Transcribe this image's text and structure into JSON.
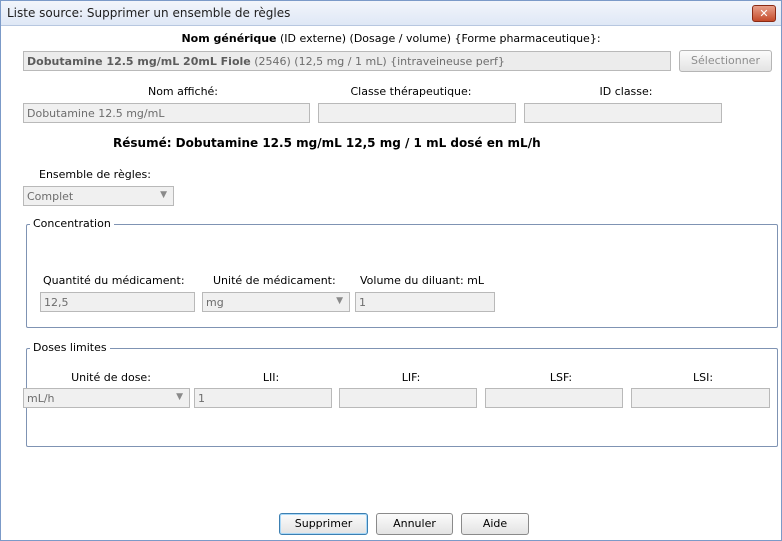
{
  "window": {
    "title": "Liste source: Supprimer un ensemble de règles",
    "close_glyph": "✕"
  },
  "generic": {
    "header_bold": "Nom générique",
    "header_rest": "(ID externe) (Dosage / volume) {Forme pharmaceutique}:",
    "name_main": "Dobutamine 12.5 mg/mL 20mL Fiole",
    "name_rest": "(2546) (12,5 mg / 1 mL) {intraveineuse perf}",
    "select_label": "Sélectionner"
  },
  "display": {
    "nom_affiche_label": "Nom affiché:",
    "classe_label": "Classe thérapeutique:",
    "id_classe_label": "ID classe:",
    "nom_affiche_value": "Dobutamine 12.5 mg/mL",
    "classe_value": "",
    "id_classe_value": ""
  },
  "summary": {
    "text": "Résumé: Dobutamine 12.5 mg/mL 12,5 mg / 1 mL dosé en mL/h"
  },
  "ruleset": {
    "label": "Ensemble de règles:",
    "value": "Complet"
  },
  "concentration": {
    "legend": "Concentration",
    "qty_label": "Quantité du médicament:",
    "unit_label": "Unité de médicament:",
    "diluent_label": "Volume du diluant: mL",
    "qty_value": "12,5",
    "unit_value": "mg",
    "diluent_value": "1"
  },
  "limits": {
    "legend": "Doses limites",
    "dose_unit_label": "Unité de dose:",
    "lii_label": "LII:",
    "lif_label": "LIF:",
    "lsf_label": "LSF:",
    "lsi_label": "LSI:",
    "dose_unit_value": "mL/h",
    "lii_value": "1",
    "lif_value": "",
    "lsf_value": "",
    "lsi_value": ""
  },
  "buttons": {
    "delete": "Supprimer",
    "cancel": "Annuler",
    "help": "Aide"
  },
  "icons": {
    "dropdown": "chevron-down-icon",
    "close": "close-icon"
  }
}
